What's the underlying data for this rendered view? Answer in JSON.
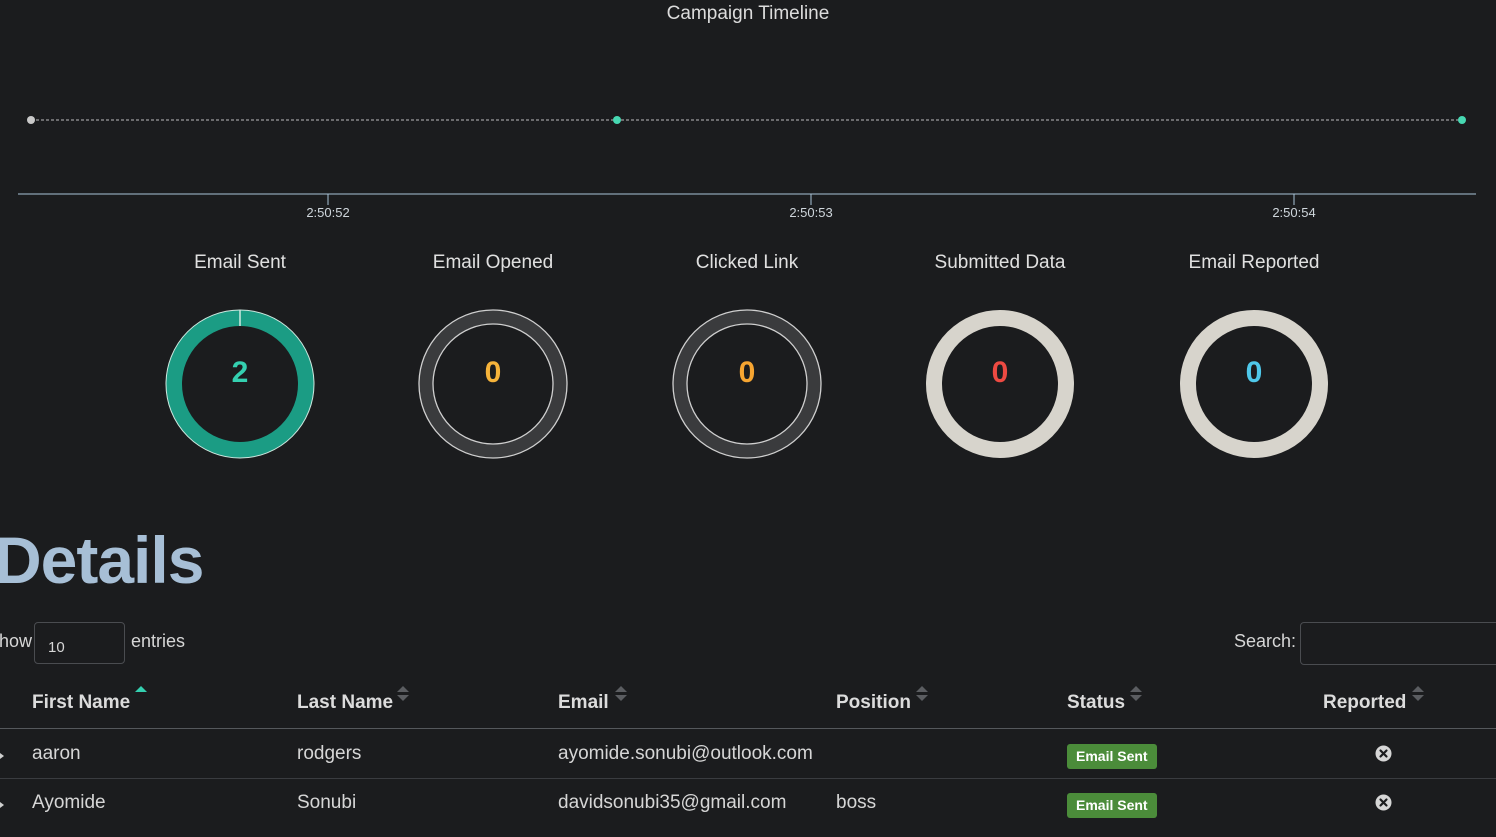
{
  "timeline": {
    "title": "Campaign Timeline",
    "ticks": [
      "2:50:52",
      "2:50:53",
      "2:50:54"
    ],
    "event_colors": [
      "#c9c9c9",
      "#47d8b2",
      "#47d8b2"
    ]
  },
  "stats": [
    {
      "title": "Email Sent",
      "value": "2",
      "value_color": "#34d0b0",
      "ring_color": "#1b9c84",
      "fill_fraction": 1.0
    },
    {
      "title": "Email Opened",
      "value": "0",
      "value_color": "#f6b33a",
      "ring_color": "#cfcfcf",
      "fill_fraction": 0
    },
    {
      "title": "Clicked Link",
      "value": "0",
      "value_color": "#f6a531",
      "ring_color": "#cfcfcf",
      "fill_fraction": 0
    },
    {
      "title": "Submitted Data",
      "value": "0",
      "value_color": "#ee4a42",
      "ring_color": "#d7d4cc",
      "fill_fraction": 0
    },
    {
      "title": "Email Reported",
      "value": "0",
      "value_color": "#4fc8ea",
      "ring_color": "#d7d4cc",
      "fill_fraction": 0
    }
  ],
  "details": {
    "heading": "Details",
    "show_label": "how",
    "page_length": "10",
    "entries_label": "entries",
    "search_label": "Search:",
    "search_value": ""
  },
  "table": {
    "columns": [
      "First Name",
      "Last Name",
      "Email",
      "Position",
      "Status",
      "Reported"
    ],
    "rows": [
      {
        "first": "aaron",
        "last": "rodgers",
        "email": "ayomide.sonubi@outlook.com",
        "position": "",
        "status": "Email Sent",
        "reported": "close-circle-icon"
      },
      {
        "first": "Ayomide",
        "last": "Sonubi",
        "email": "davidsonubi35@gmail.com",
        "position": "boss",
        "status": "Email Sent",
        "reported": "close-circle-icon"
      }
    ]
  },
  "colors": {
    "background": "#1b1c1e",
    "heading": "#a7bfd6",
    "status_badge": "#4b8c3a",
    "accent": "#47d8b2"
  }
}
